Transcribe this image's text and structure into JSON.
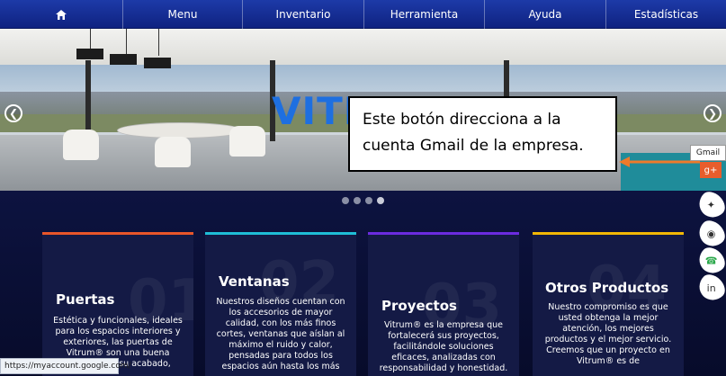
{
  "nav": {
    "home_icon": "home-icon",
    "items": [
      "Menu",
      "Inventario",
      "Herramienta",
      "Ayuda",
      "Estadísticas"
    ]
  },
  "hero": {
    "brand_text": "VITR",
    "prev_icon": "chevron-left-icon",
    "next_icon": "chevron-right-icon",
    "callout_line1": "Este botón direcciona a la",
    "callout_line2": "cuenta Gmail de la empresa.",
    "gmail_tooltip": "Gmail",
    "gmail_icon": "google-plus-icon",
    "slides": 4,
    "active_slide": 4
  },
  "cards": [
    {
      "title": "Puertas",
      "number": "01",
      "accent": "#e8562a",
      "lines": [
        "Estética y funcionales, ideales",
        "para los espacios interiores y",
        "exteriores, las puertas de",
        "Vitrum® son una buena",
        "su acabado,"
      ]
    },
    {
      "title": "Ventanas",
      "number": "02",
      "accent": "#1fbdd6",
      "lines": [
        "Nuestros diseños cuentan con",
        "los accesorios de mayor",
        "calidad, con los más finos",
        "cortes, ventanas que aíslan al",
        "máximo el ruido y calor,",
        "pensadas para todos los",
        "espacios aún hasta los más"
      ]
    },
    {
      "title": "Proyectos",
      "number": "03",
      "accent": "#6b2be0",
      "lines": [
        "Vitrum® es la empresa que",
        "fortalecerá sus proyectos,",
        "facilitándole soluciones",
        "eficaces, analizadas con",
        "responsabilidad y honestidad."
      ]
    },
    {
      "title": "Otros Productos",
      "number": "04",
      "accent": "#f2b705",
      "lines": [
        "Nuestro compromiso es que",
        "usted obtenga la mejor",
        "atención, los mejores",
        "productos y el mejor servicio.",
        "Creemos que un proyecto en",
        "Vitrum® es de"
      ]
    }
  ],
  "social_icons": [
    "twitter-icon",
    "instagram-icon",
    "whatsapp-icon",
    "linkedin-icon"
  ],
  "status_bar": {
    "url": "https://myaccount.google.com/"
  },
  "colors": {
    "nav": "#1d3aa8",
    "background": "#0b1033",
    "gmail": "#e85d2c",
    "arrow": "#ee7a2a"
  }
}
